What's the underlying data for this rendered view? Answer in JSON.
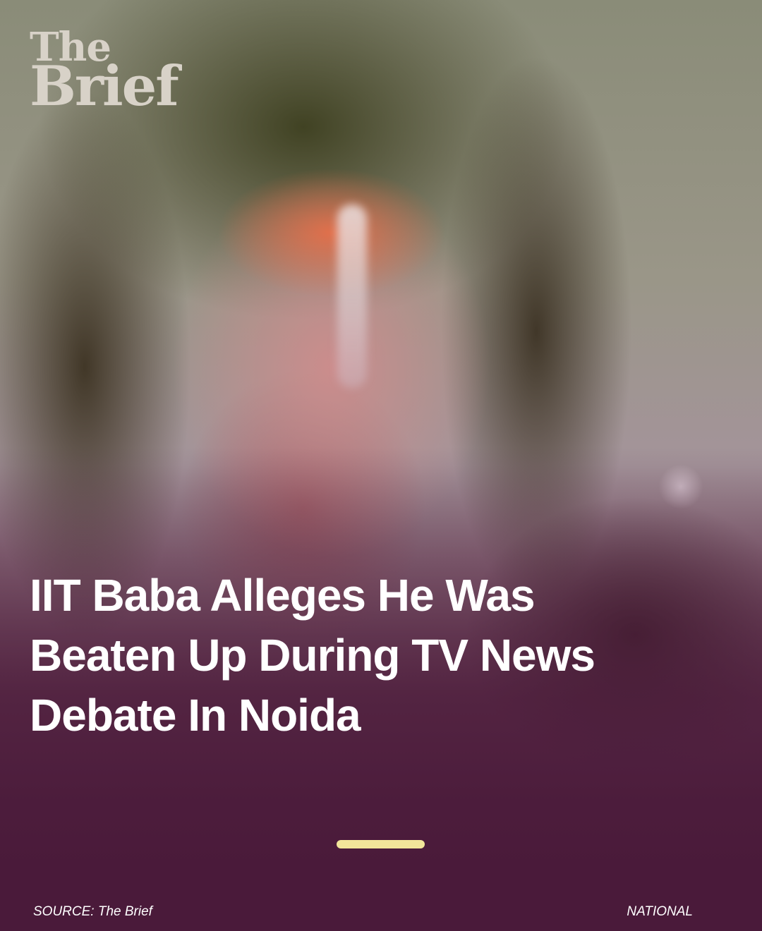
{
  "logo": {
    "line1": "The",
    "line2": "Brief"
  },
  "headline": "IIT Baba Alleges He Was Beaten Up During TV News Debate In Noida",
  "progress": {
    "color": "#f2e59a"
  },
  "footer": {
    "source": "SOURCE: The Brief",
    "category": "NATIONAL"
  },
  "colors": {
    "background": "#4a1a3a",
    "text": "#ffffff",
    "logo": "#d8d2c8"
  }
}
